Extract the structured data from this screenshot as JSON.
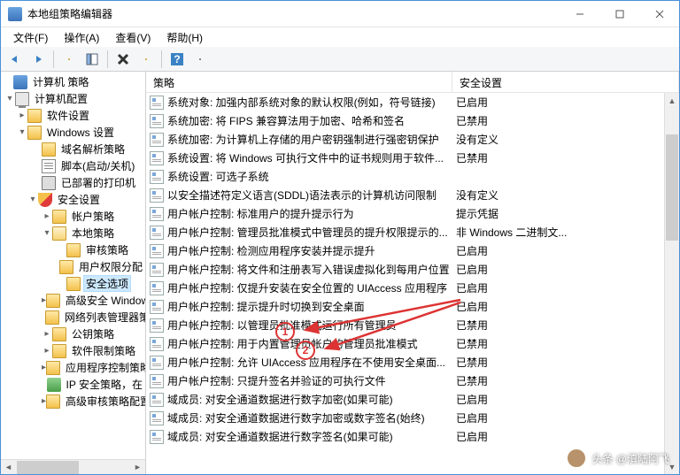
{
  "window": {
    "title": "本地组策略编辑器"
  },
  "menu": {
    "file": "文件(F)",
    "action": "操作(A)",
    "view": "查看(V)",
    "help": "帮助(H)"
  },
  "tree": {
    "root": "计算机 策略",
    "n1": "计算机配置",
    "n2": "软件设置",
    "n3": "Windows 设置",
    "n4": "域名解析策略",
    "n5": "脚本(启动/关机)",
    "n6": "已部署的打印机",
    "n7": "安全设置",
    "n8": "帐户策略",
    "n9": "本地策略",
    "n10": "审核策略",
    "n11": "用户权限分配",
    "n12": "安全选项",
    "n13": "高级安全 Windows",
    "n14": "网络列表管理器策略",
    "n15": "公钥策略",
    "n16": "软件限制策略",
    "n17": "应用程序控制策略",
    "n18": "IP 安全策略，在",
    "n19": "高级审核策略配置"
  },
  "list": {
    "col_policy": "策略",
    "col_setting": "安全设置",
    "rows": [
      {
        "p": "系统对象: 加强内部系统对象的默认权限(例如，符号链接)",
        "s": "已启用"
      },
      {
        "p": "系统加密: 将 FIPS 兼容算法用于加密、哈希和签名",
        "s": "已禁用"
      },
      {
        "p": "系统加密: 为计算机上存储的用户密钥强制进行强密钥保护",
        "s": "没有定义"
      },
      {
        "p": "系统设置: 将 Windows 可执行文件中的证书规则用于软件...",
        "s": "已禁用"
      },
      {
        "p": "系统设置: 可选子系统",
        "s": ""
      },
      {
        "p": "以安全描述符定义语言(SDDL)语法表示的计算机访问限制",
        "s": "没有定义"
      },
      {
        "p": "用户帐户控制: 标准用户的提升提示行为",
        "s": "提示凭据"
      },
      {
        "p": "用户帐户控制: 管理员批准模式中管理员的提升权限提示的...",
        "s": "非 Windows 二进制文..."
      },
      {
        "p": "用户帐户控制: 检测应用程序安装并提示提升",
        "s": "已启用"
      },
      {
        "p": "用户帐户控制: 将文件和注册表写入错误虚拟化到每用户位置",
        "s": "已启用"
      },
      {
        "p": "用户帐户控制: 仅提升安装在安全位置的 UIAccess 应用程序",
        "s": "已启用"
      },
      {
        "p": "用户帐户控制: 提示提升时切换到安全桌面",
        "s": "已启用"
      },
      {
        "p": "用户帐户控制: 以管理员批准模式运行所有管理员",
        "s": "已禁用"
      },
      {
        "p": "用户帐户控制: 用于内置管理员帐户的管理员批准模式",
        "s": "已禁用"
      },
      {
        "p": "用户帐户控制: 允许 UIAccess 应用程序在不使用安全桌面...",
        "s": "已禁用"
      },
      {
        "p": "用户帐户控制: 只提升签名并验证的可执行文件",
        "s": "已禁用"
      },
      {
        "p": "域成员: 对安全通道数据进行数字加密(如果可能)",
        "s": "已启用"
      },
      {
        "p": "域成员: 对安全通道数据进行数字加密或数字签名(始终)",
        "s": "已启用"
      },
      {
        "p": "域成员: 对安全通道数据进行数字签名(如果可能)",
        "s": "已启用"
      }
    ]
  },
  "annot": {
    "one": "1",
    "two": "2"
  },
  "watermark": "头条 @滇陆阿飞"
}
